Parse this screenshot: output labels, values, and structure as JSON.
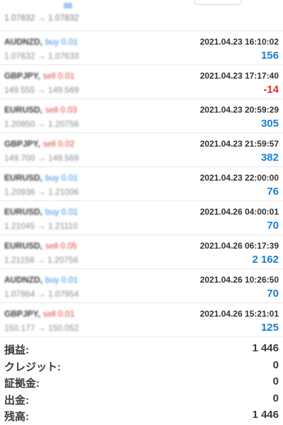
{
  "top": {
    "prices": "1.07832 → 1.07832"
  },
  "trades": [
    {
      "symbol": "AUDNZD,",
      "side": "buy 0.01",
      "side_type": "buy",
      "prices": "1.07632 → 1.07633",
      "time": "2021.04.23 16:10:02",
      "profit": "156",
      "profit_type": "pos"
    },
    {
      "symbol": "GBPJPY,",
      "side": "sell 0.01",
      "side_type": "sell",
      "prices": "149.555 → 149.569",
      "time": "2021.04.23 17:17:40",
      "profit": "-14",
      "profit_type": "neg"
    },
    {
      "symbol": "EURUSD,",
      "side": "sell 0.03",
      "side_type": "sell",
      "prices": "1.20850 → 1.20756",
      "time": "2021.04.23 20:59:29",
      "profit": "305",
      "profit_type": "pos"
    },
    {
      "symbol": "GBPJPY,",
      "side": "sell 0.02",
      "side_type": "sell",
      "prices": "149.700 → 149.569",
      "time": "2021.04.23 21:59:57",
      "profit": "382",
      "profit_type": "pos"
    },
    {
      "symbol": "EURUSD,",
      "side": "buy 0.01",
      "side_type": "buy",
      "prices": "1.20936 → 1.21006",
      "time": "2021.04.23 22:00:00",
      "profit": "76",
      "profit_type": "pos"
    },
    {
      "symbol": "EURUSD,",
      "side": "buy 0.01",
      "side_type": "buy",
      "prices": "1.21045 → 1.21110",
      "time": "2021.04.26 04:00:01",
      "profit": "70",
      "profit_type": "pos"
    },
    {
      "symbol": "EURUSD,",
      "side": "sell 0.05",
      "side_type": "sell",
      "prices": "1.21158 → 1.20756",
      "time": "2021.04.26 06:17:39",
      "profit": "2 162",
      "profit_type": "pos"
    },
    {
      "symbol": "AUDNZD,",
      "side": "buy 0.01",
      "side_type": "buy",
      "prices": "1.07864 → 1.07954",
      "time": "2021.04.26 10:26:50",
      "profit": "70",
      "profit_type": "pos"
    },
    {
      "symbol": "GBPJPY,",
      "side": "sell 0.01",
      "side_type": "sell",
      "prices": "150.177 → 150.052",
      "time": "2021.04.26 15:21:01",
      "profit": "125",
      "profit_type": "pos"
    }
  ],
  "summary": [
    {
      "label": "損益:",
      "value": "1 446"
    },
    {
      "label": "クレジット:",
      "value": "0"
    },
    {
      "label": "証拠金:",
      "value": "0"
    },
    {
      "label": "出金:",
      "value": "0"
    },
    {
      "label": "残高:",
      "value": "1 446"
    }
  ],
  "colors": {
    "buy": "#2f8fe8",
    "sell": "#e0433a",
    "profit_positive": "#1b7fd4",
    "profit_negative": "#d93025"
  }
}
